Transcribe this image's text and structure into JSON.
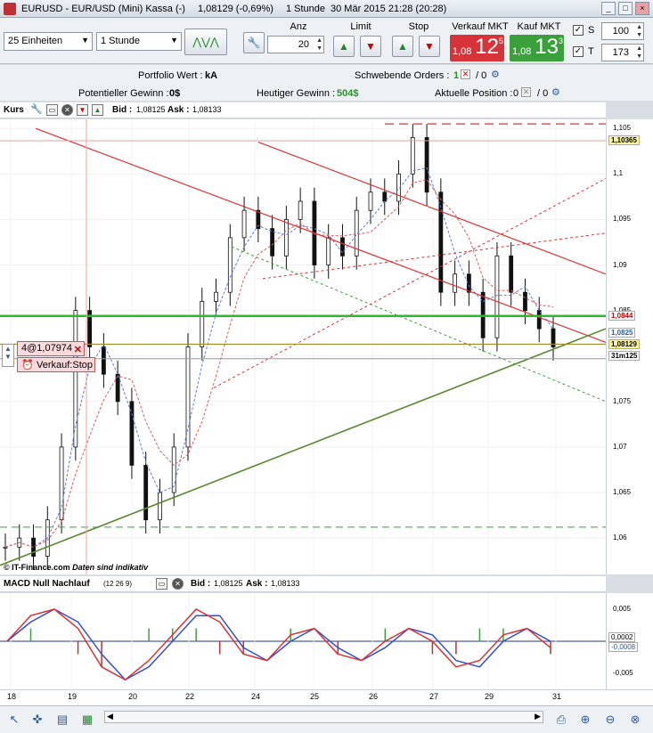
{
  "window": {
    "title": "EURUSD - EUR/USD (Mini) Kassa (-)",
    "price": "1,08129 (-0,69%)",
    "interval": "1 Stunde",
    "datetime": "30 Mär 2015 21:28 (20:28)"
  },
  "toolbar": {
    "units_select": "25 Einheiten",
    "period_select": "1 Stunde",
    "anz_label": "Anz",
    "anz_value": "20",
    "limit_label": "Limit",
    "stop_label": "Stop",
    "sell_label": "Verkauf MKT",
    "sell_small": "1,08",
    "sell_big": "12",
    "sell_sup": "5",
    "buy_label": "Kauf MKT",
    "buy_small": "1,08",
    "buy_big": "13",
    "buy_sup": "3",
    "s_label": "S",
    "s_value": "100",
    "t_label": "T",
    "t_value": "173",
    "sell_color": "#d9333a",
    "buy_color": "#3aa13a"
  },
  "info": {
    "portfolio_label": "Portfolio Wert :",
    "portfolio_value": "kA",
    "pending_label": "Schwebende Orders :",
    "pending_value_1": "1",
    "pending_value_2": "/ 0",
    "potential_label": "Potentieller Gewinn :",
    "potential_value": "0$",
    "today_label": "Heutiger Gewinn :",
    "today_value": "504$",
    "position_label": "Aktuelle Position :",
    "position_value_1": "0",
    "position_value_2": "/ 0"
  },
  "price_panel": {
    "title": "Kurs",
    "bid_label": "Bid :",
    "bid_value": "1,08125",
    "ask_label": "Ask :",
    "ask_value": "1,08133",
    "watermark": "© IT-Finance.com",
    "watermark_note": "Daten sind indikativ",
    "order_price": "4@1,07974",
    "order_type": "Verkauf:Stop"
  },
  "macd_panel": {
    "title": "MACD Null Nachlauf",
    "params": "(12 26 9)",
    "bid_label": "Bid :",
    "bid_value": "1,08125",
    "ask_label": "Ask :",
    "ask_value": "1,08133"
  },
  "chart_data": [
    {
      "type": "candlestick",
      "title": "Kurs",
      "ylim": [
        1.056,
        1.106
      ],
      "y_ticks": [
        "1,105",
        "1,1",
        "1,095",
        "1,09",
        "1,085",
        "1,08",
        "1,075",
        "1,07",
        "1,065",
        "1,06"
      ],
      "x_ticks": [
        "18",
        "19",
        "20",
        "22",
        "24",
        "25",
        "26",
        "27",
        "29",
        "31"
      ],
      "price_tags": {
        "upper_red": "1,10365",
        "green": "1,0844",
        "blue": "1,0825",
        "last": "1,08129",
        "time": "31m125"
      },
      "close_series": [
        1.059,
        1.06,
        1.058,
        1.062,
        1.07,
        1.085,
        1.081,
        1.078,
        1.075,
        1.068,
        1.062,
        1.065,
        1.07,
        1.081,
        1.086,
        1.087,
        1.093,
        1.096,
        1.094,
        1.091,
        1.095,
        1.097,
        1.09,
        1.093,
        1.091,
        1.096,
        1.098,
        1.097,
        1.1,
        1.104,
        1.098,
        1.087,
        1.089,
        1.087,
        1.082,
        1.091,
        1.087,
        1.085,
        1.083,
        1.081
      ],
      "colors": {
        "up": "#111111",
        "down": "#111111",
        "ma1": "#5a7be0",
        "ma2": "#e05a5a"
      }
    },
    {
      "type": "bar",
      "title": "MACD Null Nachlauf",
      "y_ticks": [
        "0,005",
        "-0,005"
      ],
      "tags": {
        "a": "0,0002",
        "b": "-0,0008"
      },
      "macd": [
        0.0,
        0.004,
        0.005,
        0.002,
        -0.004,
        -0.006,
        -0.003,
        0.001,
        0.005,
        0.003,
        -0.002,
        -0.003,
        0.001,
        0.002,
        -0.002,
        -0.003,
        0.0,
        0.002,
        0.0,
        -0.004,
        -0.003,
        0.001,
        0.002,
        -0.001
      ],
      "signal": [
        0.0,
        0.003,
        0.005,
        0.003,
        -0.002,
        -0.006,
        -0.004,
        0.0,
        0.004,
        0.004,
        -0.001,
        -0.003,
        0.0,
        0.002,
        -0.001,
        -0.003,
        -0.001,
        0.002,
        0.001,
        -0.003,
        -0.004,
        0.0,
        0.002,
        0.0
      ]
    }
  ]
}
